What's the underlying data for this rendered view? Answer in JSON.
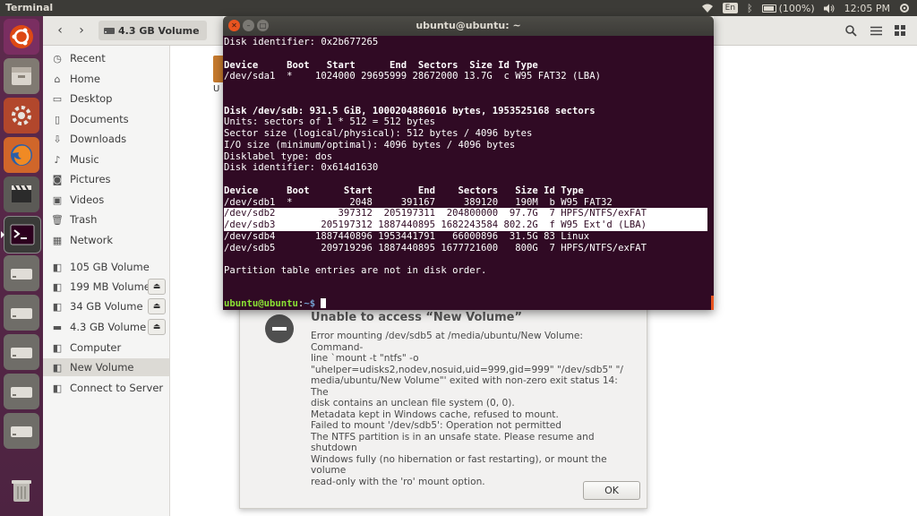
{
  "top_panel": {
    "title": "Terminal",
    "lang": "En",
    "battery": "(100%)",
    "time": "12:05 PM"
  },
  "launcher": {
    "items": [
      "ubuntu-dash-icon",
      "files-icon",
      "system-settings-icon",
      "firefox-icon",
      "video-editor-icon",
      "terminal-icon",
      "drive-icon",
      "drive-icon",
      "drive-icon",
      "drive-icon",
      "drive-icon",
      "drive-icon",
      "drive-icon",
      "trash-icon"
    ]
  },
  "file_manager": {
    "path_label": "4.3 GB Volume",
    "file_label": "U",
    "sidebar": [
      {
        "label": "Recent",
        "icon": "clock-icon"
      },
      {
        "label": "Home",
        "icon": "home-icon"
      },
      {
        "label": "Desktop",
        "icon": "folder-icon"
      },
      {
        "label": "Documents",
        "icon": "document-icon"
      },
      {
        "label": "Downloads",
        "icon": "download-icon"
      },
      {
        "label": "Music",
        "icon": "music-icon"
      },
      {
        "label": "Pictures",
        "icon": "camera-icon"
      },
      {
        "label": "Videos",
        "icon": "video-icon"
      },
      {
        "label": "Trash",
        "icon": "trash-icon"
      },
      {
        "label": "Network",
        "icon": "network-icon"
      },
      {
        "label": "105 GB Volume",
        "icon": "drive-icon"
      },
      {
        "label": "199 MB Volume",
        "icon": "drive-icon",
        "eject": true
      },
      {
        "label": "34 GB Volume",
        "icon": "drive-icon",
        "eject": true
      },
      {
        "label": "4.3 GB Volume",
        "icon": "drive-icon",
        "eject": true
      },
      {
        "label": "Computer",
        "icon": "computer-icon"
      },
      {
        "label": "New Volume",
        "icon": "drive-icon",
        "selected": true
      },
      {
        "label": "Connect to Server",
        "icon": "server-icon"
      }
    ]
  },
  "dialog": {
    "title": "Unable to access “New Volume”",
    "body": "Error mounting /dev/sdb5 at /media/ubuntu/New Volume: Command-\nline `mount -t \"ntfs\" -o\n\"uhelper=udisks2,nodev,nosuid,uid=999,gid=999\" \"/dev/sdb5\" \"/\nmedia/ubuntu/New Volume\"' exited with non-zero exit status 14: The\ndisk contains an unclean file system (0, 0).\nMetadata kept in Windows cache, refused to mount.\nFailed to mount '/dev/sdb5': Operation not permitted\nThe NTFS partition is in an unsafe state. Please resume and shutdown\nWindows fully (no hibernation or fast restarting), or mount the\nvolume\nread-only with the 'ro' mount option.",
    "ok_label": "OK"
  },
  "terminal": {
    "title": "ubuntu@ubuntu: ~",
    "lines": [
      {
        "text": "Disk identifier: 0x2b677265"
      },
      {
        "text": ""
      },
      {
        "text": "Device     Boot   Start      End  Sectors  Size Id Type",
        "bold": true
      },
      {
        "text": "/dev/sda1  *    1024000 29695999 28672000 13.7G  c W95 FAT32 (LBA)"
      },
      {
        "text": ""
      },
      {
        "text": ""
      },
      {
        "text": "Disk /dev/sdb: 931.5 GiB, 1000204886016 bytes, 1953525168 sectors",
        "bold": true
      },
      {
        "text": "Units: sectors of 1 * 512 = 512 bytes"
      },
      {
        "text": "Sector size (logical/physical): 512 bytes / 4096 bytes"
      },
      {
        "text": "I/O size (minimum/optimal): 4096 bytes / 4096 bytes"
      },
      {
        "text": "Disklabel type: dos"
      },
      {
        "text": "Disk identifier: 0x614d1630"
      },
      {
        "text": ""
      },
      {
        "text": "Device     Boot      Start        End    Sectors   Size Id Type",
        "bold": true
      },
      {
        "text": "/dev/sdb1  *          2048     391167     389120   190M  b W95 FAT32"
      },
      {
        "text": "/dev/sdb2           397312  205197311  204800000  97.7G  7 HPFS/NTFS/exFAT",
        "highlight": true
      },
      {
        "text": "/dev/sdb3        205197312 1887440895 1682243584 802.2G  f W95 Ext'd (LBA)",
        "highlight": true
      },
      {
        "text": "/dev/sdb4       1887440896 1953441791   66000896  31.5G 83 Linux"
      },
      {
        "text": "/dev/sdb5        209719296 1887440895 1677721600   800G  7 HPFS/NTFS/exFAT"
      },
      {
        "text": ""
      },
      {
        "text": "Partition table entries are not in disk order."
      }
    ],
    "prompt_user": "ubuntu@ubuntu",
    "prompt_sep": ":",
    "prompt_path": "~$ "
  }
}
